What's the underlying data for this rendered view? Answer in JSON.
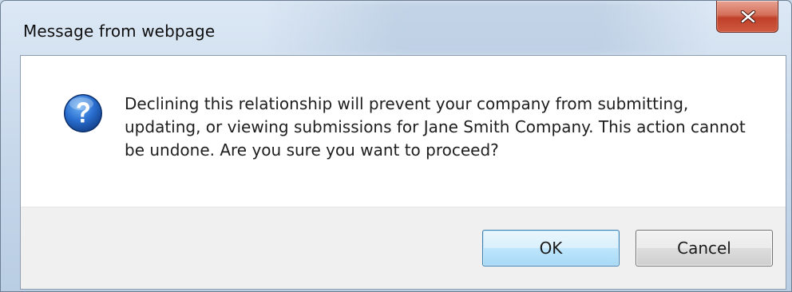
{
  "window": {
    "title": "Message from webpage"
  },
  "dialog": {
    "icon": "question-icon",
    "message": "Declining this relationship will prevent your company from submitting, updating, or viewing submissions for Jane Smith Company. This action cannot be undone. Are you sure you want to proceed?"
  },
  "buttons": {
    "ok_label": "OK",
    "cancel_label": "Cancel"
  },
  "colors": {
    "close_button": "#c9513b",
    "ok_button_border": "#3c7fb1",
    "question_icon": "#1f5fb8"
  }
}
